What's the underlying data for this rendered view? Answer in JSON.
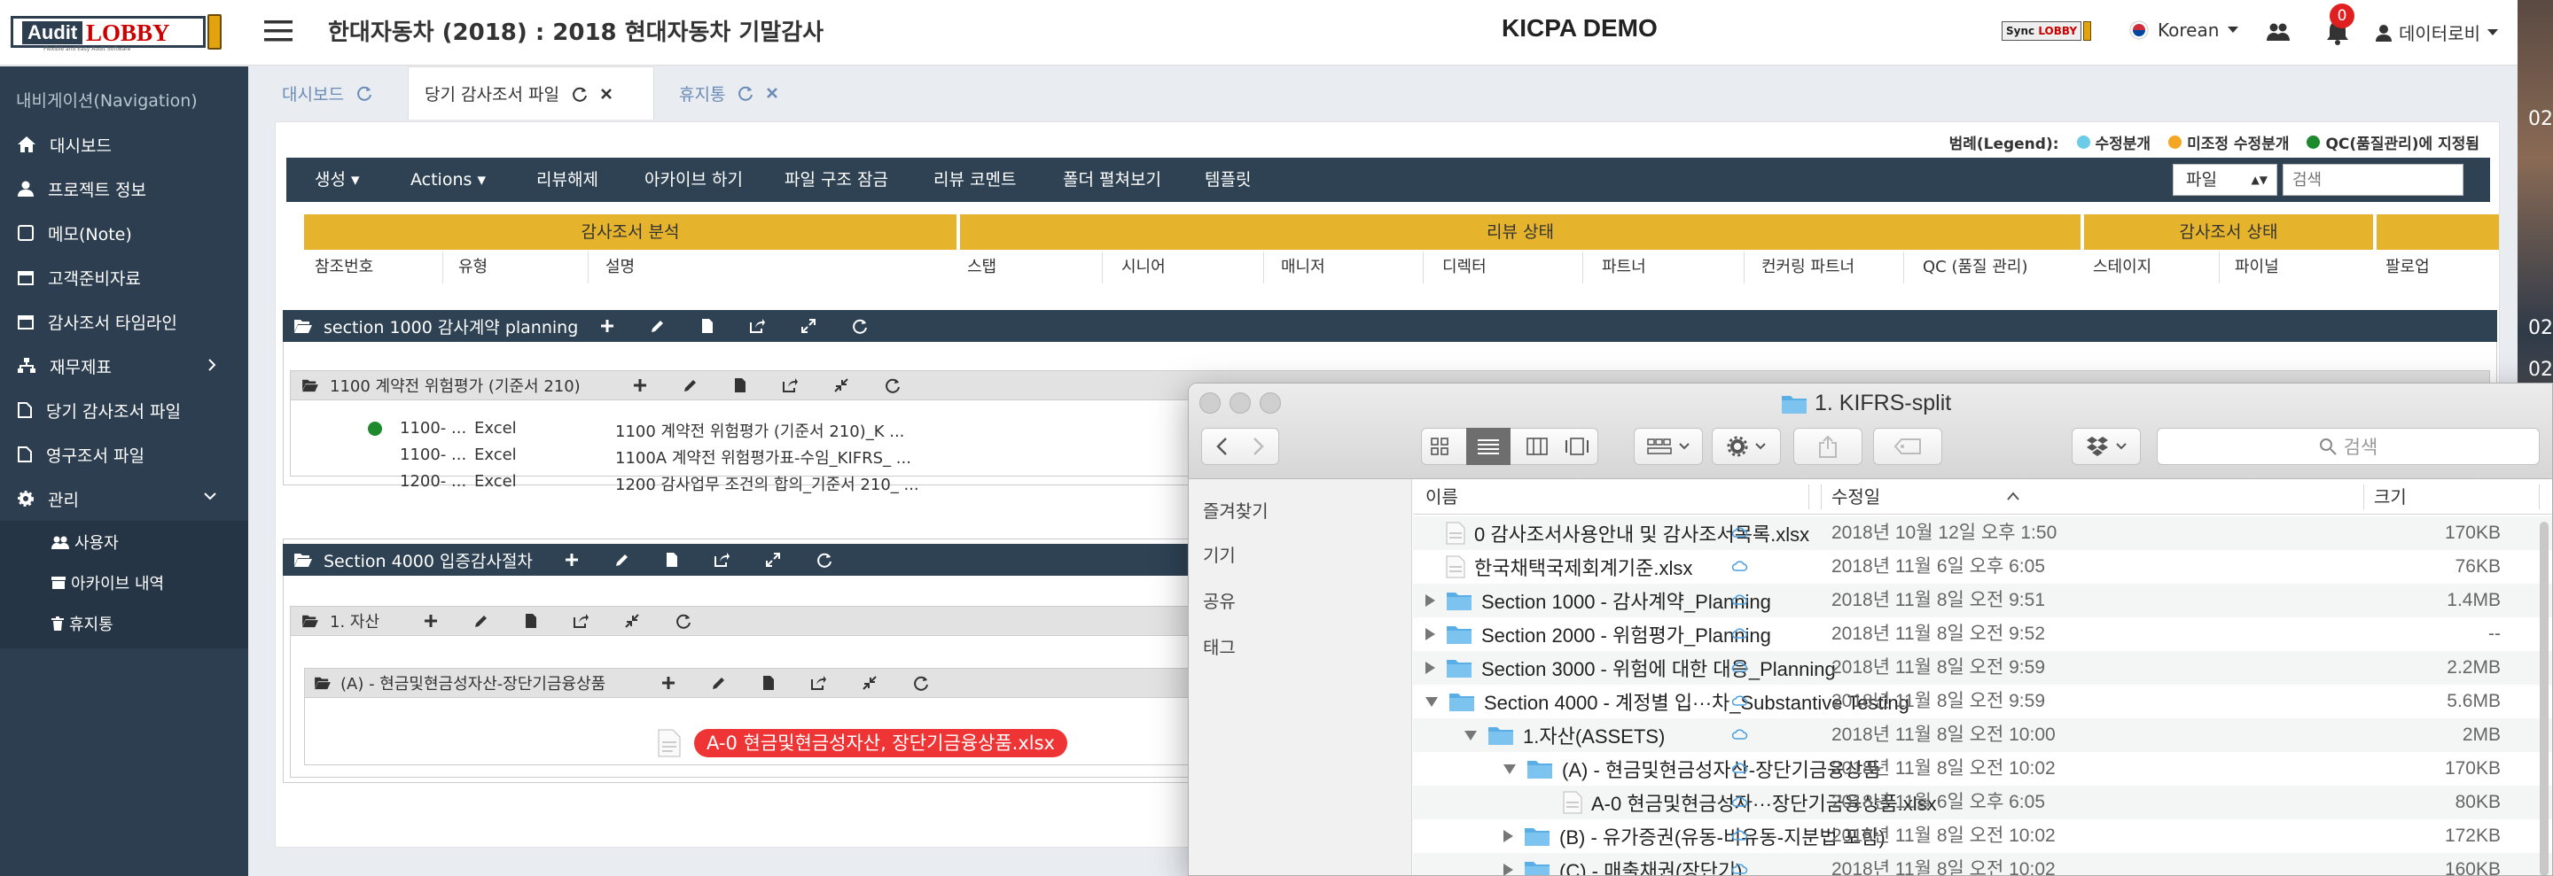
{
  "app": {
    "logo_audit": "Audit",
    "logo_lobby": "LOBBY",
    "logo_tagline": "Flexible and Easy Audit Software",
    "page_title": "한대자동차 (2018) : 2018 현대자동차 기말감사",
    "center_title": "KICPA DEMO",
    "sync_label": "Sync",
    "sync_lobby": "LOBBY",
    "language": "Korean",
    "notification_count": "0",
    "user_name": "데이터로비",
    "strip_numbers": [
      "02",
      "02",
      "02"
    ]
  },
  "sidebar": {
    "header": "내비게이션(Navigation)",
    "items": [
      {
        "label": "대시보드",
        "icon": "home-icon"
      },
      {
        "label": "프로젝트 정보",
        "icon": "user-icon"
      },
      {
        "label": "메모(Note)",
        "icon": "note-icon"
      },
      {
        "label": "고객준비자료",
        "icon": "calendar-icon"
      },
      {
        "label": "감사조서 타임라인",
        "icon": "calendar-icon"
      },
      {
        "label": "재무제표",
        "icon": "sitemap-icon"
      },
      {
        "label": "당기 감사조서 파일",
        "icon": "file-icon"
      },
      {
        "label": "영구조서 파일",
        "icon": "file-icon"
      },
      {
        "label": "관리",
        "icon": "gear-icon"
      }
    ],
    "sub_items": [
      {
        "label": "사용자",
        "icon": "users-icon"
      },
      {
        "label": "아카이브 내역",
        "icon": "archive-icon"
      },
      {
        "label": "휴지통",
        "icon": "trash-icon"
      }
    ]
  },
  "tabs": [
    {
      "label": "대시보드"
    },
    {
      "label": "당기 감사조서 파일"
    },
    {
      "label": "휴지통"
    }
  ],
  "legend": {
    "title": "범례(Legend):",
    "items": [
      {
        "label": "수정분개",
        "color": "#6ccbe8"
      },
      {
        "label": "미조정 수정분개",
        "color": "#f5a623"
      },
      {
        "label": "QC(품질관리)에 지정됨",
        "color": "#1e8a2e"
      }
    ]
  },
  "toolbar": {
    "items": [
      "생성",
      "Actions",
      "리뷰해제",
      "아카이브 하기",
      "파일 구조 잠금",
      "리뷰 코멘트",
      "폴더 펼쳐보기",
      "템플릿"
    ],
    "filetype": "파일",
    "search_placeholder": "검색"
  },
  "table": {
    "groups": [
      "감사조서 분석",
      "리뷰 상태",
      "감사조서 상태",
      ""
    ],
    "columns": [
      "참조번호",
      "유형",
      "설명",
      "스탭",
      "시니어",
      "매니저",
      "디렉터",
      "파트너",
      "컨커링 파트너",
      "QC (품질 관리)",
      "스테이지",
      "파이널",
      "팔로업"
    ]
  },
  "sections": {
    "s1000": "section 1000 감사계약 planning",
    "s1100": "1100 계약전 위험평가 (기준서 210)",
    "s1100_rows": [
      {
        "ref": "1100- ...",
        "type": "Excel",
        "desc": "1100 계약전 위험평가 (기준서 210)_K ..."
      },
      {
        "ref": "1100- ...",
        "type": "Excel",
        "desc": "1100A 계약전 위험평가표-수임_KIFRS_ ..."
      },
      {
        "ref": "1200- ...",
        "type": "Excel",
        "desc": "1200 감사업무 조건의 합의_기준서 210_ ..."
      }
    ],
    "s4000": "Section 4000 입증감사절차",
    "asset": "1. 자산",
    "cash": "(A) - 현금및현금성자산-장단기금융상품",
    "drag_file": "A-0 현금및현금성자산, 장단기금융상품.xlsx"
  },
  "finder": {
    "title": "1. KIFRS-split",
    "search_placeholder": "검색",
    "sidebar": [
      "즐겨찾기",
      "기기",
      "공유",
      "태그"
    ],
    "columns": {
      "name": "이름",
      "date": "수정일",
      "size": "크기"
    },
    "rows": [
      {
        "name": "0 감사조서사용안내 및 감사조서목록.xlsx",
        "date": "2018년 10월 12일 오후 1:50",
        "size": "170KB",
        "kind": "xlsx",
        "indent": 0,
        "toggle": "none"
      },
      {
        "name": "한국채택국제회계기준.xlsx",
        "date": "2018년 11월 6일 오후 6:05",
        "size": "76KB",
        "kind": "xlsx",
        "indent": 0,
        "toggle": "none"
      },
      {
        "name": "Section 1000 - 감사계약_Planning",
        "date": "2018년 11월 8일 오전 9:51",
        "size": "1.4MB",
        "kind": "folder",
        "indent": 0,
        "toggle": "right"
      },
      {
        "name": "Section 2000 - 위험평가_Planning",
        "date": "2018년 11월 8일 오전 9:52",
        "size": "--",
        "kind": "folder",
        "indent": 0,
        "toggle": "right"
      },
      {
        "name": "Section 3000 - 위험에 대한 대응_Planning",
        "date": "2018년 11월 8일 오전 9:59",
        "size": "2.2MB",
        "kind": "folder",
        "indent": 0,
        "toggle": "right"
      },
      {
        "name": "Section 4000 - 계정별 입···차_Substantive Testing",
        "date": "2018년 11월 8일 오전 9:59",
        "size": "5.6MB",
        "kind": "folder",
        "indent": 0,
        "toggle": "down"
      },
      {
        "name": "1.자산(ASSETS)",
        "date": "2018년 11월 8일 오전 10:00",
        "size": "2MB",
        "kind": "folder",
        "indent": 1,
        "toggle": "down"
      },
      {
        "name": "(A) - 현금및현금성자산-장단기금융상품",
        "date": "2018년 11월 8일 오전 10:02",
        "size": "170KB",
        "kind": "folder",
        "indent": 2,
        "toggle": "down"
      },
      {
        "name": "A-0 현금및현금성자···장단기금융상품.xlsx",
        "date": "2018년 11월 6일 오후 6:05",
        "size": "80KB",
        "kind": "xlsx",
        "indent": 3,
        "toggle": "none"
      },
      {
        "name": "(B) - 유가증권(유동-비유동-지분법 포함)",
        "date": "2018년 11월 8일 오전 10:02",
        "size": "172KB",
        "kind": "folder",
        "indent": 2,
        "toggle": "right"
      },
      {
        "name": "(C) - 매출채권(장단기)",
        "date": "2018년 11월 8일 오전 10:02",
        "size": "160KB",
        "kind": "folder",
        "indent": 2,
        "toggle": "right"
      }
    ]
  },
  "colors": {
    "navy": "#2d3e50",
    "gold": "#e6b42c",
    "accent_red": "#ee3434",
    "link_blue": "#6a8bb5"
  }
}
